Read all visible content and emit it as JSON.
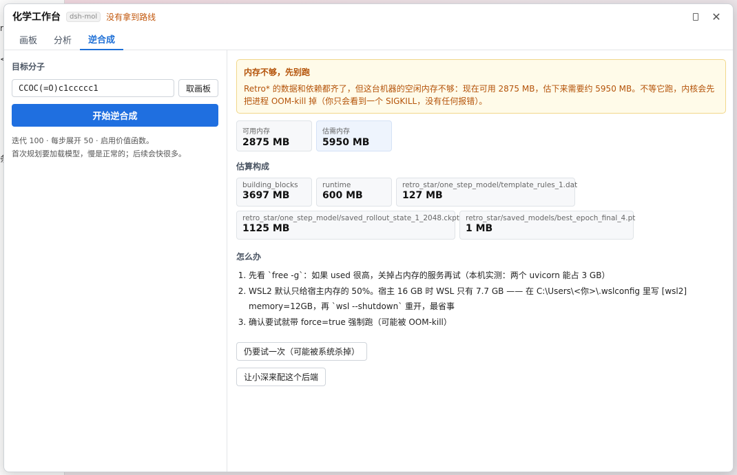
{
  "background": {
    "frag1": "r",
    "frag2": "<",
    "frag3": "条"
  },
  "window": {
    "title": "化学工作台",
    "badge": "dsh-mol",
    "route_status": "没有拿到路线",
    "close_glyph": "✕"
  },
  "tabs": [
    {
      "label": "画板",
      "active": false
    },
    {
      "label": "分析",
      "active": false
    },
    {
      "label": "逆合成",
      "active": true
    }
  ],
  "left": {
    "target_label": "目标分子",
    "smiles_value": "CCOC(=O)c1ccccc1",
    "fetch_button": "取画板",
    "start_button": "开始逆合成",
    "hint_line1": "迭代 100 · 每步展开 50 · 启用价值函数。",
    "hint_line2": "首次规划要加载模型，慢是正常的；后续会快很多。"
  },
  "alert": {
    "title": "内存不够，先别跑",
    "body": "Retro* 的数据和依赖都齐了，但这台机器的空闲内存不够：现在可用 2875 MB，估下来需要约 5950 MB。不等它跑，内核会先把进程 OOM-kill 掉（你只会看到一个 SIGKILL，没有任何报错）。"
  },
  "memory": {
    "available_label": "可用内存",
    "available_value": "2875 MB",
    "needed_label": "估需内存",
    "needed_value": "5950 MB"
  },
  "breakdown": {
    "title": "估算构成",
    "items": [
      {
        "label": "building_blocks",
        "value": "3697 MB"
      },
      {
        "label": "runtime",
        "value": "600 MB"
      },
      {
        "label": "retro_star/one_step_model/template_rules_1.dat",
        "value": "127 MB"
      },
      {
        "label": "retro_star/one_step_model/saved_rollout_state_1_2048.ckpt",
        "value": "1125 MB"
      },
      {
        "label": "retro_star/saved_models/best_epoch_final_4.pt",
        "value": "1 MB"
      }
    ]
  },
  "howto": {
    "title": "怎么办",
    "steps": [
      "先看 `free -g`：如果 used 很高，关掉占内存的服务再试（本机实测：两个 uvicorn 能占 3 GB）",
      "WSL2 默认只给宿主内存的 50%。宿主 16 GB 时 WSL 只有 7.7 GB —— 在 C:\\Users\\<你>\\.wslconfig 里写 [wsl2] memory=12GB，再 `wsl --shutdown` 重开，最省事",
      "确认要试就带 force=true 强制跑（可能被 OOM-kill）"
    ]
  },
  "actions": {
    "force_button": "仍要试一次（可能被系统杀掉）",
    "configure_button": "让小深来配这个后端"
  }
}
